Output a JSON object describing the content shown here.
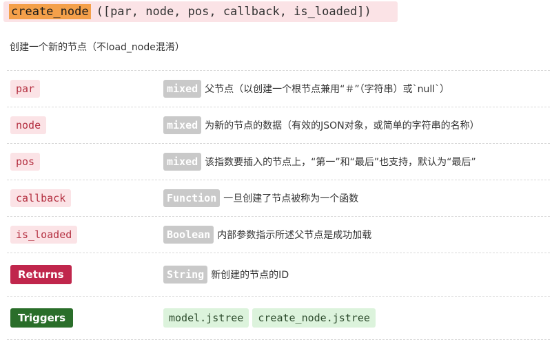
{
  "signature": {
    "name": "create_node",
    "args": "([par, node, pos, callback, is_loaded])"
  },
  "description": "创建一个新的节点（不load_node混淆）",
  "params": [
    {
      "name": "par",
      "type": "mixed",
      "desc": "父节点（以创建一个根节点兼用“＃”（字符串）或`null`）"
    },
    {
      "name": "node",
      "type": "mixed",
      "desc": "为新的节点的数据（有效的JSON对象，或简单的字符串的名称）"
    },
    {
      "name": "pos",
      "type": "mixed",
      "desc": "该指数要插入的节点上，“第一”和“最后”也支持，默认为“最后”"
    },
    {
      "name": "callback",
      "type": "Function",
      "desc": "一旦创建了节点被称为一个函数"
    },
    {
      "name": "is_loaded",
      "type": "Boolean",
      "desc": "内部参数指示所述父节点是成功加载"
    }
  ],
  "returns": {
    "label": "Returns",
    "type": "String",
    "desc": "新创建的节点的ID"
  },
  "triggers": {
    "label": "Triggers",
    "events": [
      "model.jstree",
      "create_node.jstree"
    ]
  },
  "colors": {
    "param_bg": "#fbe3e6",
    "param_text": "#b42f40",
    "type_bg": "#c9c9c9",
    "returns_bg": "#c0264c",
    "triggers_bg": "#2a6e2a",
    "event_bg": "#dcf3dc",
    "highlight": "#f4a04a"
  }
}
